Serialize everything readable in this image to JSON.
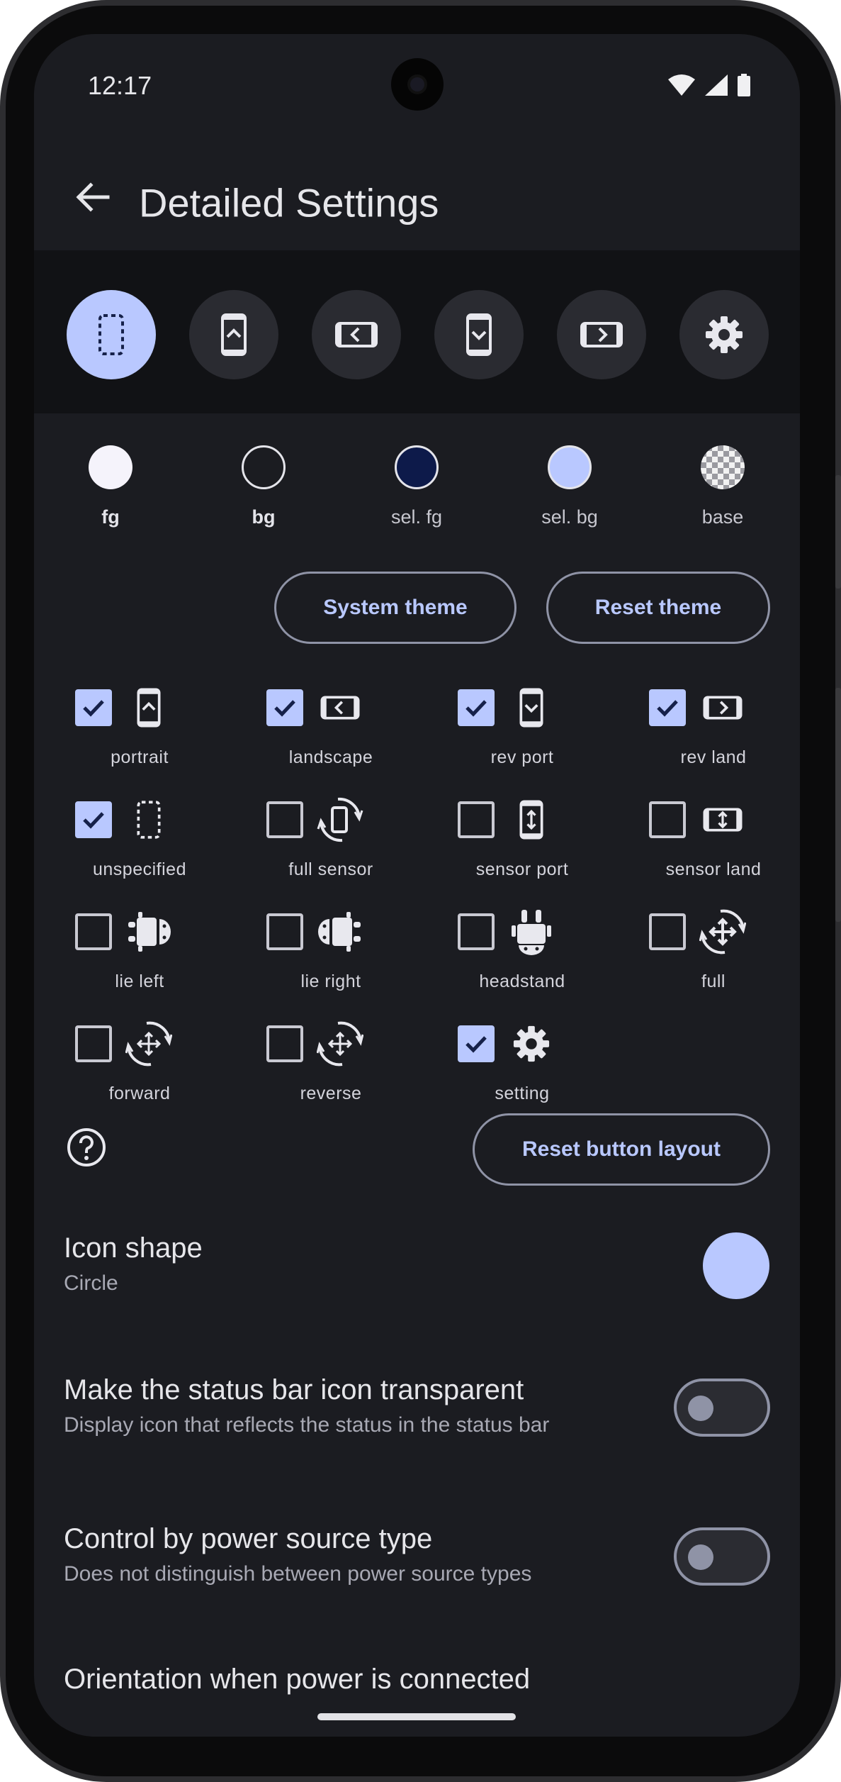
{
  "status_bar": {
    "time": "12:17"
  },
  "app_bar": {
    "title": "Detailed Settings"
  },
  "mode_buttons": [
    {
      "icon": "unspecified-icon",
      "selected": true
    },
    {
      "icon": "portrait-icon",
      "selected": false
    },
    {
      "icon": "landscape-icon",
      "selected": false
    },
    {
      "icon": "rev-port-icon",
      "selected": false
    },
    {
      "icon": "rev-land-icon",
      "selected": false
    },
    {
      "icon": "gear-icon",
      "selected": false
    }
  ],
  "colors": [
    {
      "label": "fg",
      "color": "#f5f3fb"
    },
    {
      "label": "bg",
      "color": "#1b1c21"
    },
    {
      "label": "sel. fg",
      "color": "#0d1a4a"
    },
    {
      "label": "sel. bg",
      "color": "#b9c8ff"
    },
    {
      "label": "base",
      "color": "checker"
    }
  ],
  "theme_buttons": {
    "system": "System theme",
    "reset": "Reset theme"
  },
  "orientations": [
    {
      "label": "portrait",
      "checked": true,
      "icon": "portrait-icon"
    },
    {
      "label": "landscape",
      "checked": true,
      "icon": "landscape-icon"
    },
    {
      "label": "rev port",
      "checked": true,
      "icon": "rev-port-icon"
    },
    {
      "label": "rev land",
      "checked": true,
      "icon": "rev-land-icon"
    },
    {
      "label": "unspecified",
      "checked": true,
      "icon": "unspecified-icon"
    },
    {
      "label": "full sensor",
      "checked": false,
      "icon": "full-sensor-icon"
    },
    {
      "label": "sensor port",
      "checked": false,
      "icon": "sensor-port-icon"
    },
    {
      "label": "sensor land",
      "checked": false,
      "icon": "sensor-land-icon"
    },
    {
      "label": "lie left",
      "checked": false,
      "icon": "robot-left-icon"
    },
    {
      "label": "lie right",
      "checked": false,
      "icon": "robot-right-icon"
    },
    {
      "label": "headstand",
      "checked": false,
      "icon": "robot-headstand-icon"
    },
    {
      "label": "full",
      "checked": false,
      "icon": "full-rotate-icon"
    },
    {
      "label": "forward",
      "checked": false,
      "icon": "forward-rotate-icon"
    },
    {
      "label": "reverse",
      "checked": false,
      "icon": "reverse-rotate-icon"
    },
    {
      "label": "setting",
      "checked": true,
      "icon": "gear-icon"
    }
  ],
  "reset_layout_label": "Reset button layout",
  "icon_shape": {
    "title": "Icon shape",
    "value": "Circle"
  },
  "status_bar_icon": {
    "title": "Make the status bar icon transparent",
    "subtitle": "Display icon that reflects the status in the status bar",
    "enabled": false
  },
  "power_source": {
    "title": "Control by power source type",
    "subtitle": "Does not distinguish between power source types",
    "enabled": false
  },
  "power_orientation": {
    "title": "Orientation when power is connected"
  },
  "accent_color": "#b9c8ff"
}
